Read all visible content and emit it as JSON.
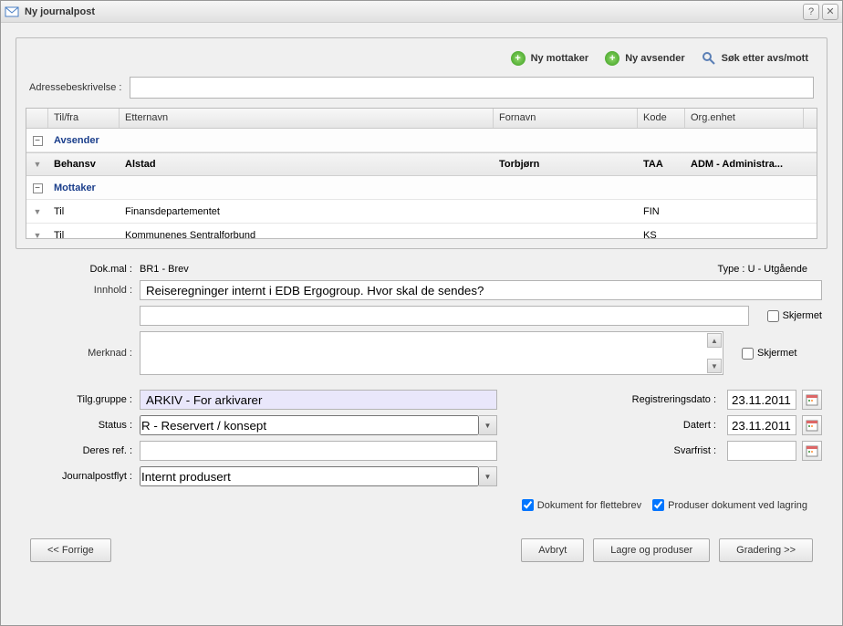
{
  "title": "Ny journalpost",
  "toolbar": {
    "new_recipient": "Ny mottaker",
    "new_sender": "Ny avsender",
    "search": "Søk etter avs/mott"
  },
  "addr_label": "Adressebeskrivelse :",
  "grid": {
    "headers": {
      "tilfra": "Til/fra",
      "etternavn": "Etternavn",
      "fornavn": "Fornavn",
      "kode": "Kode",
      "orgenhet": "Org.enhet"
    },
    "group_sender": "Avsender",
    "group_recipient": "Mottaker",
    "rows": {
      "r1": {
        "tilfra": "Behansv",
        "etternavn": "Alstad",
        "fornavn": "Torbjørn",
        "kode": "TAA",
        "enhet": "ADM - Administra..."
      },
      "r2": {
        "tilfra": "Til",
        "etternavn": "Finansdepartementet",
        "fornavn": "",
        "kode": "FIN",
        "enhet": ""
      },
      "r3": {
        "tilfra": "Til",
        "etternavn": "Kommunenes Sentralforbund",
        "fornavn": "",
        "kode": "KS",
        "enhet": ""
      }
    }
  },
  "form": {
    "dokmal_label": "Dok.mal :",
    "dokmal_value": "BR1 - Brev",
    "type_label": "Type :",
    "type_value": "U - Utgående",
    "innhold_label": "Innhold :",
    "innhold_value": "Reiseregninger internt i EDB Ergogroup. Hvor skal de sendes?",
    "skjermet": "Skjermet",
    "merknad_label": "Merknad :",
    "tilg_label": "Tilg.gruppe :",
    "tilg_value": "ARKIV - For arkivarer",
    "status_label": "Status :",
    "status_value": "R - Reservert / konsept",
    "deresref_label": "Deres ref. :",
    "jpflyt_label": "Journalpostflyt :",
    "jpflyt_value": "Internt produsert",
    "regdato_label": "Registreringsdato :",
    "regdato_value": "23.11.2011",
    "datert_label": "Datert :",
    "datert_value": "23.11.2011",
    "svarfrist_label": "Svarfrist :",
    "chk_flettebrev": "Dokument for flettebrev",
    "chk_produser": "Produser dokument ved lagring"
  },
  "buttons": {
    "prev": "<< Forrige",
    "cancel": "Avbryt",
    "save": "Lagre og produser",
    "grading": "Gradering >>"
  }
}
